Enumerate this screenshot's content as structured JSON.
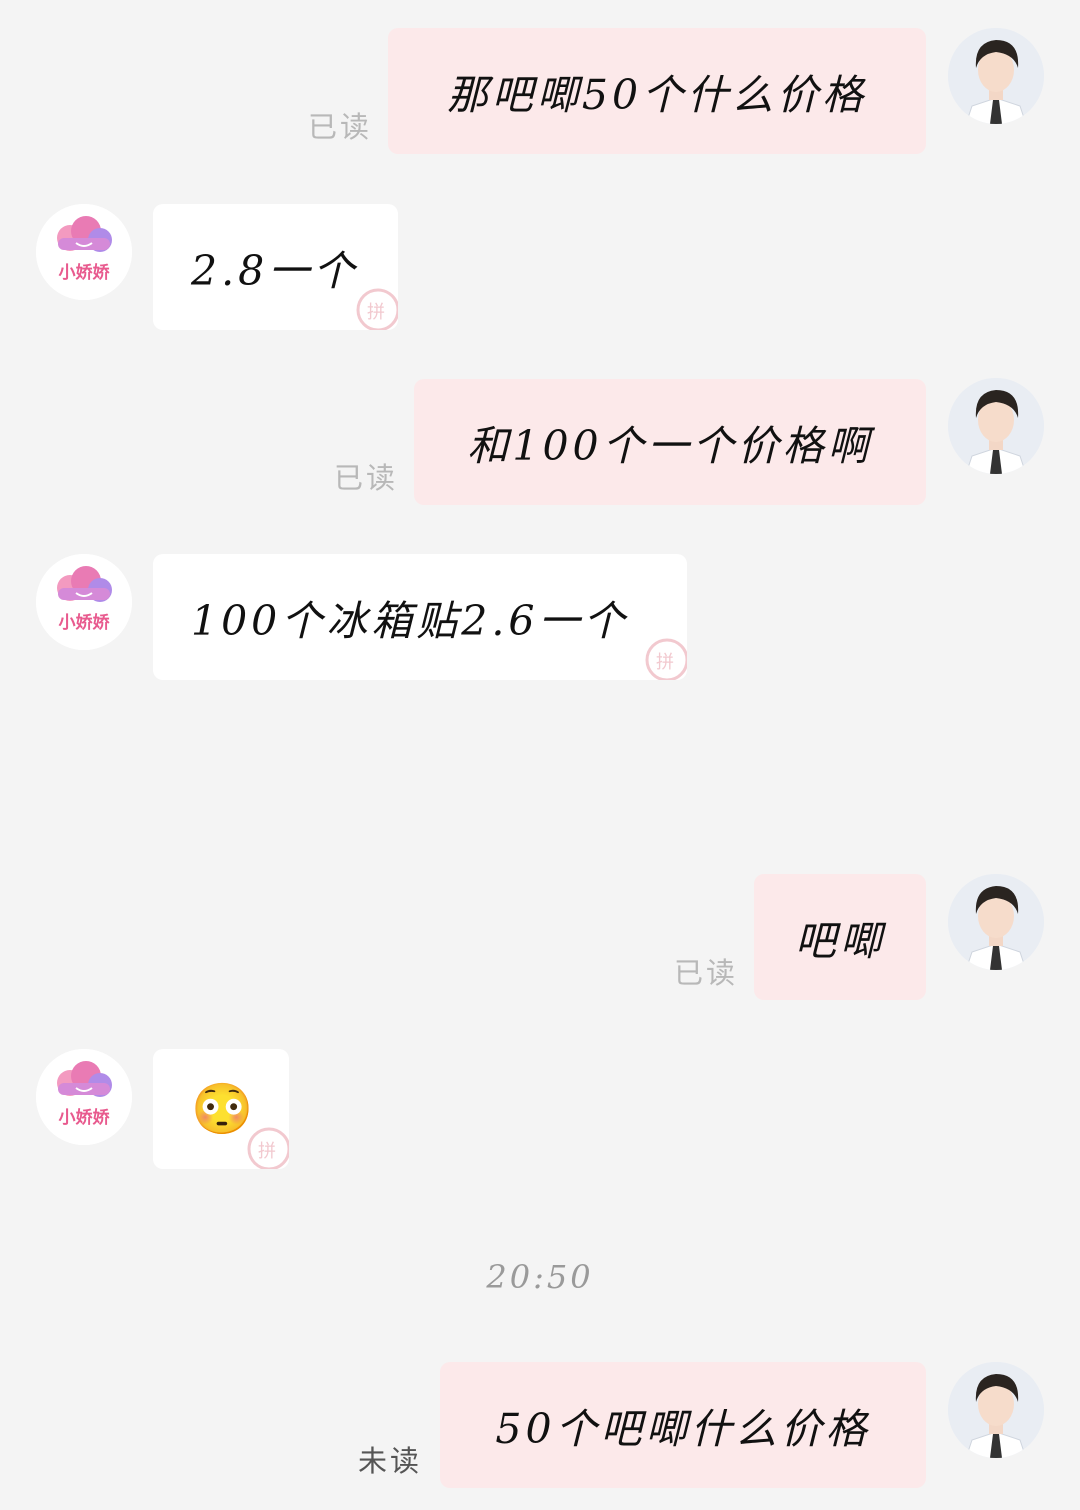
{
  "messages": [
    {
      "text": "那吧唧50个什么价格",
      "status": "已读"
    },
    {
      "text": "2.8一个"
    },
    {
      "text": "和100个一个价格啊",
      "status": "已读"
    },
    {
      "text": "100个冰箱贴2.6一个"
    },
    {
      "text": "吧唧",
      "status": "已读"
    },
    {
      "emoji": "😳",
      "icon": "confused-face-emoji"
    },
    {
      "text": "50个吧唧什么价格",
      "status": "未读"
    }
  ],
  "timestamp": "20:50",
  "shop": {
    "name": "小娇娇"
  },
  "colors": {
    "background": "#f4f4f4",
    "my_bubble": "#fce9ea",
    "their_bubble": "#ffffff",
    "read_status": "#b8b8b8",
    "unread_status": "#555555",
    "logo_pink": "#e85a8e"
  }
}
